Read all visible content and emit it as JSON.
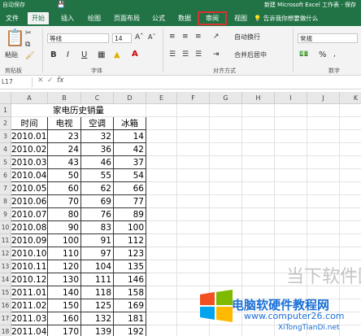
{
  "titlebar": {
    "autosave": "自动保存",
    "title": "新建 Microsoft Excel 工作表 - 保存"
  },
  "tabs": [
    {
      "label": "文件"
    },
    {
      "label": "开始"
    },
    {
      "label": "插入"
    },
    {
      "label": "绘图"
    },
    {
      "label": "页面布局"
    },
    {
      "label": "公式"
    },
    {
      "label": "数据"
    },
    {
      "label": "审阅"
    },
    {
      "label": "视图"
    }
  ],
  "tellme": "告诉我你想要做什么",
  "ribbon": {
    "paste_label": "粘贴",
    "font_name": "等线",
    "font_size": "14",
    "bold": "B",
    "italic": "I",
    "underline": "U",
    "wrap_text": "自动换行",
    "merge_center": "合并后居中",
    "number_format": "常规",
    "percent": "%",
    "groups": {
      "clipboard": "剪贴板",
      "font": "字体",
      "alignment": "对齐方式",
      "number": "数字"
    }
  },
  "formula_bar": {
    "name_box": "L17",
    "fx": "fx"
  },
  "columns": [
    "A",
    "B",
    "C",
    "D",
    "E",
    "F",
    "G",
    "H",
    "I",
    "J",
    "K"
  ],
  "sheet": {
    "title": "家电历史销量",
    "headers": [
      "时间",
      "电视",
      "空调",
      "冰箱"
    ],
    "rows": [
      [
        "2010.01",
        "23",
        "32",
        "14"
      ],
      [
        "2010.02",
        "24",
        "36",
        "42"
      ],
      [
        "2010.03",
        "43",
        "46",
        "37"
      ],
      [
        "2010.04",
        "50",
        "55",
        "54"
      ],
      [
        "2010.05",
        "60",
        "62",
        "66"
      ],
      [
        "2010.06",
        "70",
        "69",
        "77"
      ],
      [
        "2010.07",
        "80",
        "76",
        "89"
      ],
      [
        "2010.08",
        "90",
        "83",
        "100"
      ],
      [
        "2010.09",
        "100",
        "91",
        "112"
      ],
      [
        "2010.10",
        "110",
        "97",
        "123"
      ],
      [
        "2010.11",
        "120",
        "104",
        "135"
      ],
      [
        "2010.12",
        "130",
        "111",
        "146"
      ],
      [
        "2011.01",
        "140",
        "118",
        "158"
      ],
      [
        "2011.02",
        "150",
        "125",
        "169"
      ],
      [
        "2011.03",
        "160",
        "132",
        "181"
      ],
      [
        "2011.04",
        "170",
        "139",
        "192"
      ]
    ],
    "row_numbers": [
      "1",
      "2",
      "3",
      "4",
      "5",
      "6",
      "7",
      "8",
      "9",
      "10",
      "11",
      "12",
      "13",
      "14",
      "15",
      "16",
      "17",
      "18"
    ]
  },
  "watermark": {
    "line1": "当下软件园",
    "line2": "电脑软硬件教程网",
    "line3": "www.computer26.com",
    "line4": "XiTongTianDi.net"
  }
}
